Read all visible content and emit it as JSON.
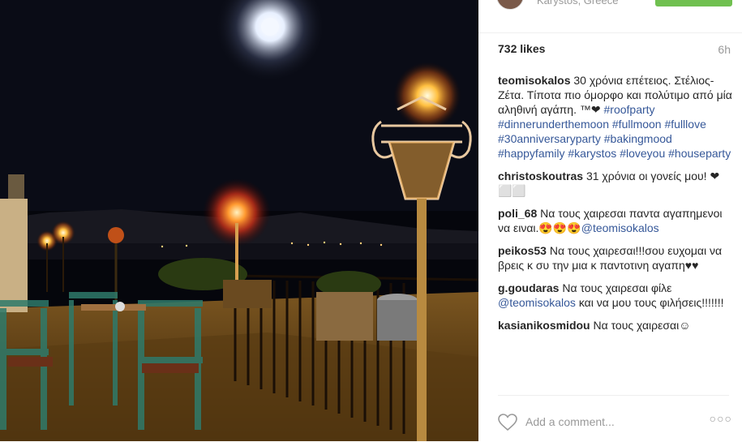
{
  "header": {
    "location": "Karystos, Greece"
  },
  "post": {
    "likes": "732 likes",
    "time_ago": "6h"
  },
  "caption": {
    "user": "teomisokalos",
    "text": "30 χρόνια επέτειος. Στέλιος-Ζέτα. Τίποτα πιο όμορφο και πολύτιμο από μία αληθινή αγάπη. ™❤",
    "hashtags": [
      "#roofparty",
      "#dinnerunderthemoon",
      "#fullmoon",
      "#fulllove",
      "#30anniversaryparty",
      "#bakingmood",
      "#happyfamily",
      "#karystos",
      "#loveyou",
      "#houseparty"
    ]
  },
  "comments": [
    {
      "user": "christoskoutras",
      "text": "31 χρόνια οι γονείς μου! ❤ ⬜⬜"
    },
    {
      "user": "poli_68",
      "text": "Να τους χαιρεσαι παντα αγαπημενοι να ειναι.😍😍😍",
      "mention": "@teomisokalos"
    },
    {
      "user": "peikos53",
      "text": "Να τους χαιρεσαι!!!σου ευχομαι να βρεις κ συ την μια κ παντοτινη αγαπη♥♥"
    },
    {
      "user": "g.goudaras",
      "text": "Να τους χαιρεσαι φίλε",
      "mention": "@teomisokalos",
      "text2": "και να μου τους φιλήσεις!!!!!!!"
    },
    {
      "user": "kasianikosmidou",
      "text": "Να τους χαιρεσαι☺"
    }
  ],
  "footer": {
    "add_comment_placeholder": "Add a comment...",
    "more_label": "○○○"
  },
  "icons": {
    "like": "heart-icon",
    "more": "more-options-icon"
  },
  "colors": {
    "link": "#365899",
    "follow_button": "#70c050"
  }
}
